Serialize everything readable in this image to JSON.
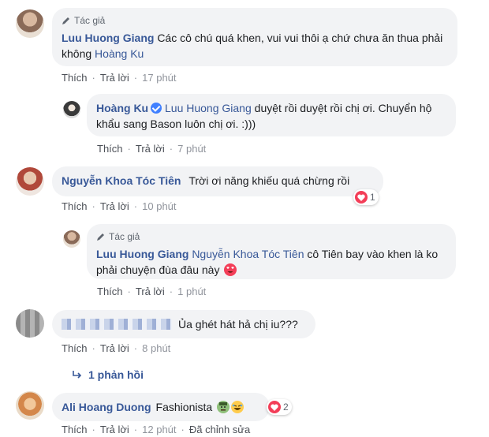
{
  "labels": {
    "author_tag": "Tác giả",
    "like": "Thích",
    "reply": "Trả lời",
    "edited": "Đã chỉnh sửa"
  },
  "comments": [
    {
      "name": "Luu Huong Giang",
      "text": "Các cô chú quá khen, vui vui thôi ạ chứ chưa ăn thua phải không",
      "mention": "Hoàng Ku",
      "time": "17 phút"
    },
    {
      "name": "Hoàng Ku",
      "mention": "Luu Huong Giang",
      "text": "duyệt rồi duyệt rồi chị ơi. Chuyển hộ khẩu sang Bason luôn chị ơi. :)))",
      "time": "7 phút"
    },
    {
      "name": "Nguyễn Khoa Tóc Tiên",
      "text": "Trời ơi năng khiếu quá chừng rồi",
      "time": "10 phút",
      "reaction_count": "1"
    },
    {
      "name": "Luu Huong Giang",
      "mention": "Nguyễn Khoa Tóc Tiên",
      "text": "cô Tiên bay vào khen là ko phải chuyện đùa đâu này",
      "time": "1 phút"
    },
    {
      "text": "Ủa ghét hát hả chị iu???",
      "time": "8 phút",
      "replies_label": "1 phản hồi"
    },
    {
      "name": "Ali Hoang Duong",
      "text": "Fashionista",
      "time": "12 phút",
      "reaction_count": "2"
    }
  ],
  "colors": {
    "link_blue": "#385898",
    "bubble_bg": "#f2f3f5",
    "meta_gray": "#90949c",
    "heart_red": "#f33e58"
  }
}
